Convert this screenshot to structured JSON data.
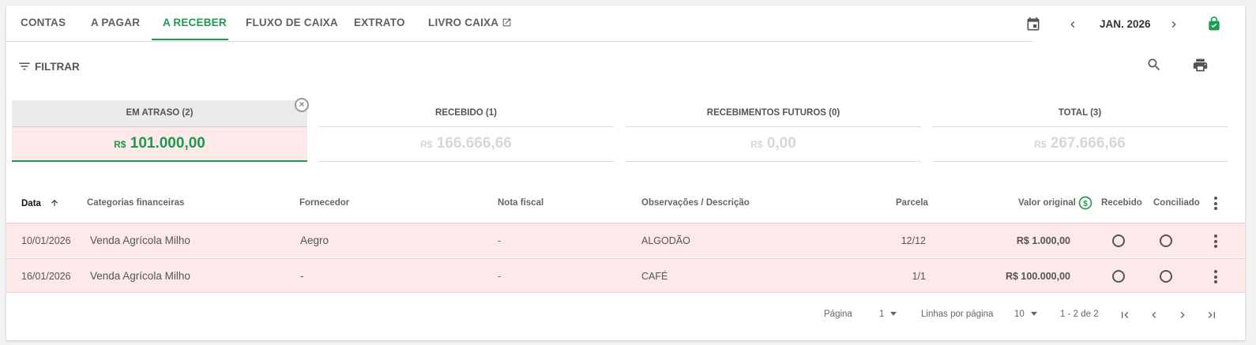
{
  "tabs": [
    {
      "label": "CONTAS"
    },
    {
      "label": "A PAGAR"
    },
    {
      "label": "A RECEBER"
    },
    {
      "label": "FLUXO DE CAIXA"
    },
    {
      "label": "EXTRATO"
    },
    {
      "label": "LIVRO CAIXA"
    }
  ],
  "active_tab": "A RECEBER",
  "period": "JAN. 2026",
  "filter_label": "FILTRAR",
  "summary": [
    {
      "title": "EM ATRASO (2)",
      "currency": "R$",
      "value": "101.000,00"
    },
    {
      "title": "RECEBIDO (1)",
      "currency": "R$",
      "value": "166.666,66"
    },
    {
      "title": "RECEBIMENTOS FUTUROS (0)",
      "currency": "R$",
      "value": "0,00"
    },
    {
      "title": "TOTAL (3)",
      "currency": "R$",
      "value": "267.666,66"
    }
  ],
  "table": {
    "headers": {
      "data": "Data",
      "categorias": "Categorias financeiras",
      "fornecedor": "Fornecedor",
      "nota": "Nota fiscal",
      "obs": "Observações / Descrição",
      "parcela": "Parcela",
      "valor": "Valor original",
      "recebido": "Recebido",
      "conciliado": "Conciliado"
    },
    "rows": [
      {
        "data": "10/01/2026",
        "categoria": "Venda Agrícola Milho",
        "fornecedor": "Aegro",
        "nota": "-",
        "obs": "ALGODÃO",
        "parcela": "12/12",
        "valor": "R$ 1.000,00"
      },
      {
        "data": "16/01/2026",
        "categoria": "Venda Agrícola Milho",
        "fornecedor": "-",
        "nota": "-",
        "obs": "CAFÉ",
        "parcela": "1/1",
        "valor": "R$ 100.000,00"
      }
    ]
  },
  "footer": {
    "page_label": "Página",
    "page_value": "1",
    "rows_label": "Linhas por página",
    "rows_value": "10",
    "range": "1 - 2 de 2"
  },
  "colors": {
    "accent": "#1a9b4e",
    "overdue_bg": "#fde9e9"
  },
  "icons": [
    "calendar-icon",
    "chevron-left-icon",
    "chevron-right-icon",
    "lock-check-icon",
    "filter-icon",
    "search-icon",
    "print-icon",
    "close-circle-icon",
    "sort-arrow-up-icon",
    "dollar-circle-icon",
    "more-vert-icon",
    "first-page-icon",
    "last-page-icon"
  ]
}
